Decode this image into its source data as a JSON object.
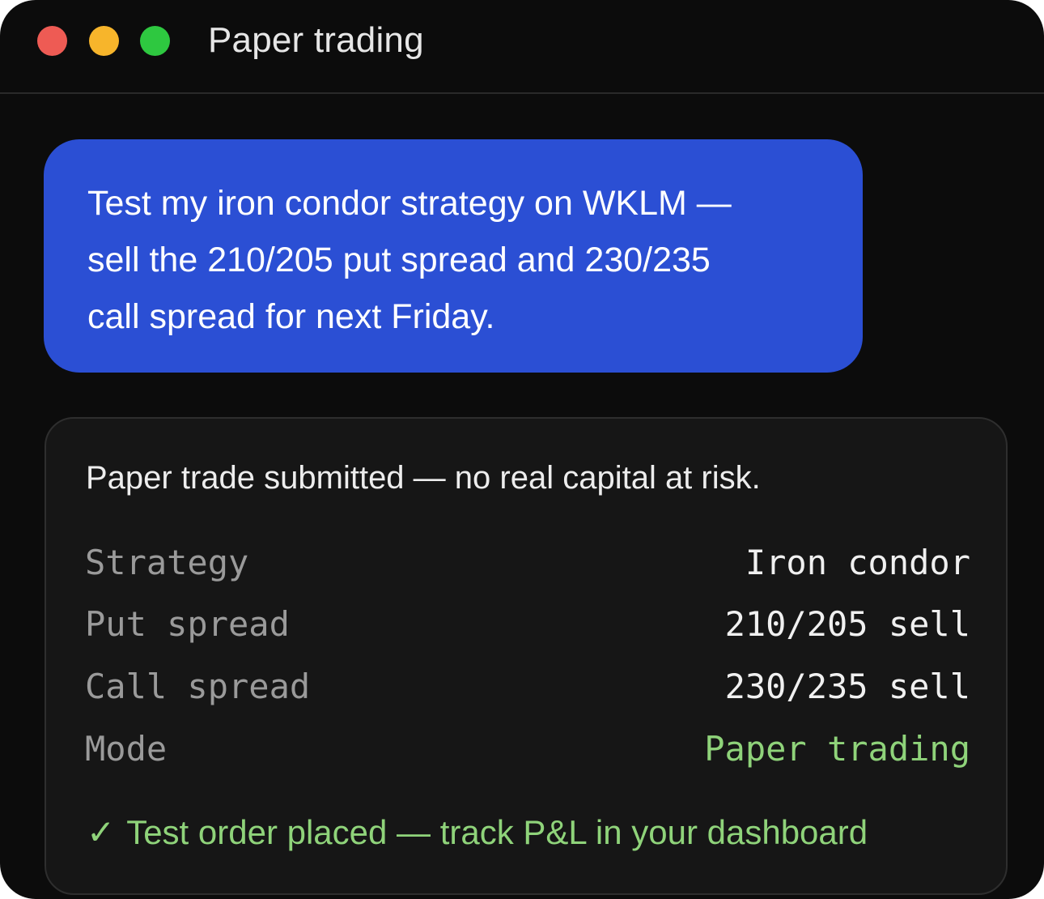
{
  "window": {
    "title": "Paper trading",
    "controls": [
      {
        "name": "close",
        "color": "#ee5b54"
      },
      {
        "name": "minimize",
        "color": "#f7b52b"
      },
      {
        "name": "zoom",
        "color": "#2ec840"
      }
    ]
  },
  "user_message": {
    "line1": "Test my iron condor strategy on WKLM —",
    "line2": "sell the 210/205 put spread and 230/235",
    "line3": "call spread for next Friday.",
    "bubble_color": "#2b4fd4"
  },
  "result_card": {
    "headline": "Paper trade submitted — no real capital at risk.",
    "rows": [
      {
        "label": "Strategy",
        "value": "Iron condor"
      },
      {
        "label": "Put spread",
        "value": "210/205 sell"
      },
      {
        "label": "Call spread",
        "value": "230/235 sell"
      },
      {
        "label": "Mode",
        "value": "Paper trading"
      }
    ],
    "confirmation_icon": "✓",
    "confirmation": "Test order placed — track P&L in your dashboard",
    "accent_color": "#8fd37a"
  }
}
